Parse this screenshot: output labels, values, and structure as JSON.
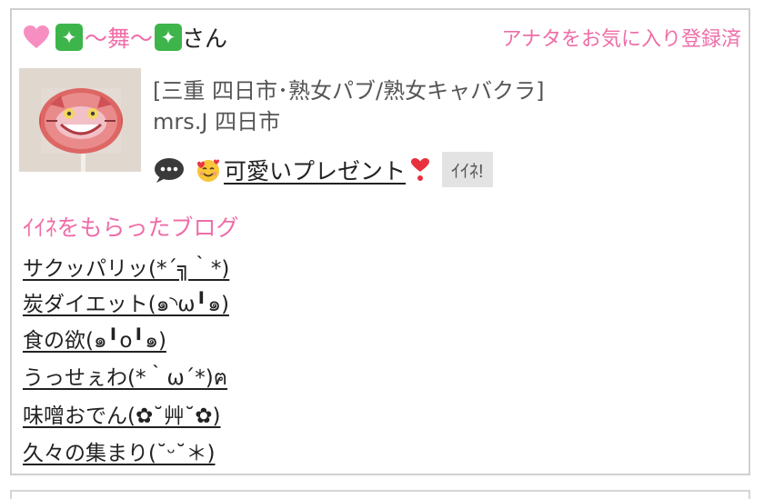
{
  "header": {
    "name_prefix_icon": "pink-heart",
    "name_sparkle_icon": "sparkle-box",
    "name_text": "～舞～",
    "name_suffix": "さん",
    "favorite_status": "アナタをお気に入り登録済"
  },
  "shop": {
    "thumbnail_icon": "lollipop-cheshire-cat-photo",
    "category_line": "[三重 四日市･熟女パブ/熟女キャバクラ]",
    "shop_name": "mrs.J 四日市"
  },
  "post": {
    "bubble_icon": "speech-bubble",
    "title": "可愛いプレゼント",
    "like_label": "ｲｲﾈ!"
  },
  "liked_blogs": {
    "heading": "ｲｲﾈをもらったブログ",
    "items": [
      "サクッパリッ(*´╗｀*)",
      "炭ダイエット(๑◝ω╹๑)",
      "食の欲(๑╹o╹๑)",
      "うっせぇわ(*｀ω´*)ฅ",
      "味噌おでん(✿˘艸˘✿)",
      "久々の集まり(˘ᵕ˘＊)"
    ]
  },
  "colors": {
    "accent_pink": "#ee6ea8",
    "sparkle_green": "#3db54a",
    "border_gray": "#cfcfcf",
    "like_button_bg": "#e3e3e3"
  }
}
